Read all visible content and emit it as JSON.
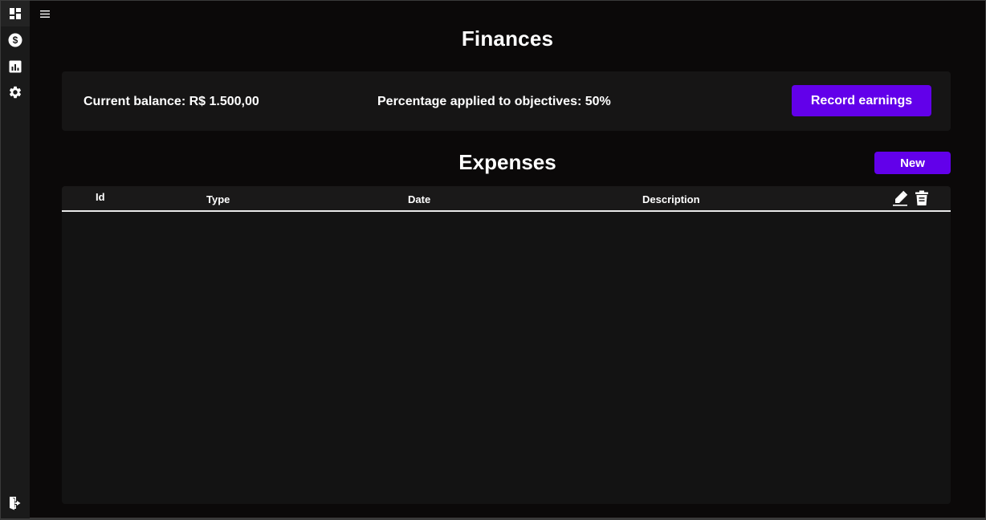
{
  "sidebar": {
    "items": [
      {
        "name": "dashboard",
        "icon": "dashboard-icon"
      },
      {
        "name": "finances",
        "icon": "dollar-icon"
      },
      {
        "name": "reports",
        "icon": "bar-chart-icon"
      },
      {
        "name": "settings",
        "icon": "gear-icon"
      }
    ],
    "logout_icon": "logout-icon"
  },
  "header": {
    "menu_icon": "menu-icon",
    "title": "Finances"
  },
  "summary": {
    "balance": "Current balance: R$ 1.500,00",
    "percentage": "Percentage applied to objectives: 50%",
    "record_button": "Record earnings"
  },
  "expenses": {
    "title": "Expenses",
    "new_button": "New",
    "columns": [
      "Id",
      "Type",
      "Date",
      "Description"
    ],
    "action_icons": [
      "edit-icon",
      "trash-icon"
    ],
    "rows": []
  },
  "colors": {
    "accent": "#6200ea",
    "background": "#0b0909",
    "sidebar": "#1a1a1a",
    "card": "#161515"
  }
}
